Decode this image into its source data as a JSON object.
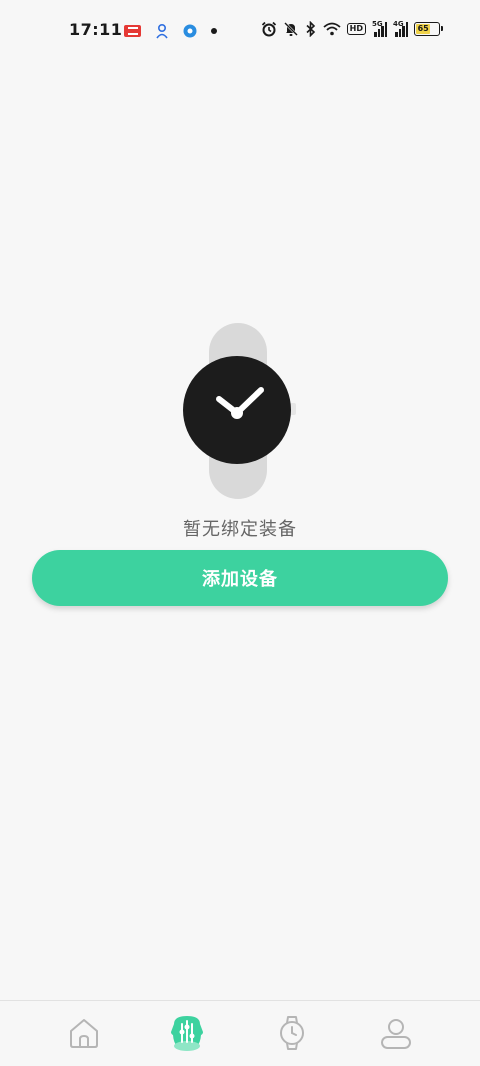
{
  "status_bar": {
    "time": "17:11",
    "battery_level": "65",
    "icons": [
      "news-icon",
      "baidu-icon",
      "app-icon",
      "dot-icon",
      "alarm-icon",
      "mute-icon",
      "bluetooth-icon",
      "wifi-icon",
      "hd-icon",
      "signal-icon",
      "signal-icon",
      "battery-icon"
    ],
    "hd_label": "HD",
    "signal_1_label": "5G",
    "signal_2_label": "4G"
  },
  "empty_state": {
    "illustration": "watch-illustration",
    "message": "暂无绑定装备"
  },
  "add_device_button": {
    "label": "添加设备",
    "color": "#3dd29f"
  },
  "bottom_nav": {
    "items": [
      {
        "icon": "home-icon",
        "active": false
      },
      {
        "icon": "sport-icon",
        "active": true
      },
      {
        "icon": "watch-icon",
        "active": false
      },
      {
        "icon": "profile-icon",
        "active": false
      }
    ],
    "active_color": "#3dd29f",
    "inactive_color": "#b5b5b5"
  }
}
